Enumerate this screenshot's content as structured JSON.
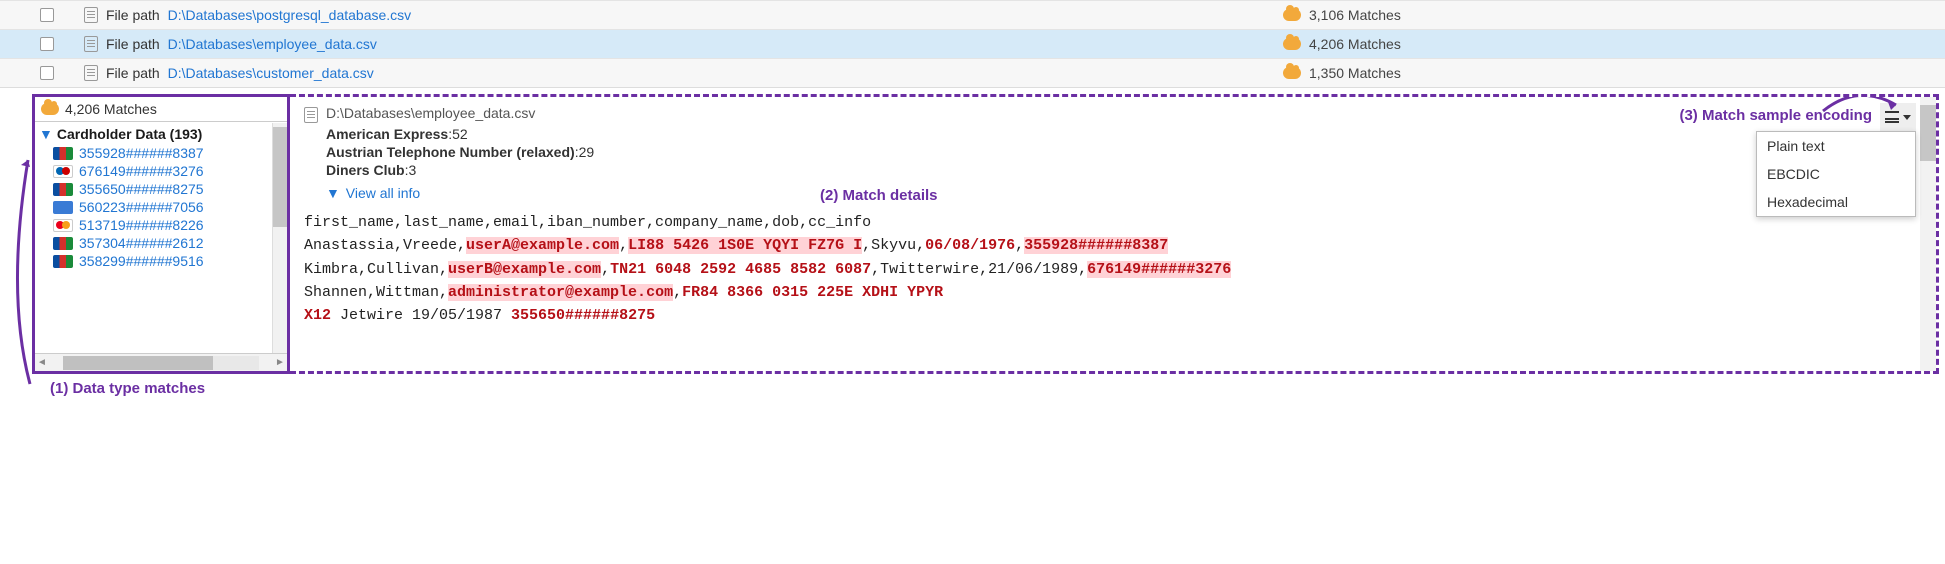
{
  "file_rows": [
    {
      "path_label": "File path",
      "path": "D:\\Databases\\postgresql_database.csv",
      "matches": "3,106 Matches",
      "selected": false
    },
    {
      "path_label": "File path",
      "path": "D:\\Databases\\employee_data.csv",
      "matches": "4,206 Matches",
      "selected": true
    },
    {
      "path_label": "File path",
      "path": "D:\\Databases\\customer_data.csv",
      "matches": "1,350 Matches",
      "selected": false
    }
  ],
  "left": {
    "total": "4,206 Matches",
    "group_label": "Cardholder Data (193)",
    "cards": [
      {
        "brand": "jcb",
        "num": "355928######8387"
      },
      {
        "brand": "maestro",
        "num": "676149######3276"
      },
      {
        "brand": "jcb",
        "num": "355650######8275"
      },
      {
        "brand": "other",
        "num": "560223######7056"
      },
      {
        "brand": "mc",
        "num": "513719######8226"
      },
      {
        "brand": "jcb",
        "num": "357304######2612"
      },
      {
        "brand": "jcb",
        "num": "358299######9516"
      }
    ]
  },
  "details": {
    "path": "D:\\Databases\\employee_data.csv",
    "stats": [
      {
        "name": "American Express",
        "count": "52"
      },
      {
        "name": "Austrian Telephone Number (relaxed)",
        "count": "29"
      },
      {
        "name": "Diners Club",
        "count": "3"
      }
    ],
    "view_all": "View all info",
    "sample": {
      "header": "first_name,last_name,email,iban_number,company_name,dob,cc_info",
      "row1a": "Anastassia,Vreede,",
      "row1b": "userA@example.com",
      "row1c": ",",
      "row1d": "LI88 5426 1S0E YQYI FZ7G I",
      "row1e": ",Skyvu,",
      "row1f": "06/08/1976",
      "row1g": ",",
      "row1h": "355928######8387",
      "row2a": "Kimbra,Cullivan,",
      "row2b": "userB@example.com",
      "row2c": ",",
      "row2d": "TN21 6048 2592 4685 8582 6087",
      "row2e": ",Twitterwire,21/06/1989,",
      "row2f": "676149######3276",
      "row3a": "Shannen,Wittman,",
      "row3b": "administrator@example.com",
      "row3c": ",",
      "row3d": "FR84 8366 0315 225E XDHI YPYR",
      "row4a": "X12",
      "row4b": " Jetwire 19/05/1987 ",
      "row4c": "355650######8275"
    }
  },
  "encoding": {
    "options": [
      "Plain text",
      "EBCDIC",
      "Hexadecimal"
    ]
  },
  "annotations": {
    "a1": "(1) Data type matches",
    "a2": "(2) Match details",
    "a3": "(3) Match sample encoding"
  }
}
